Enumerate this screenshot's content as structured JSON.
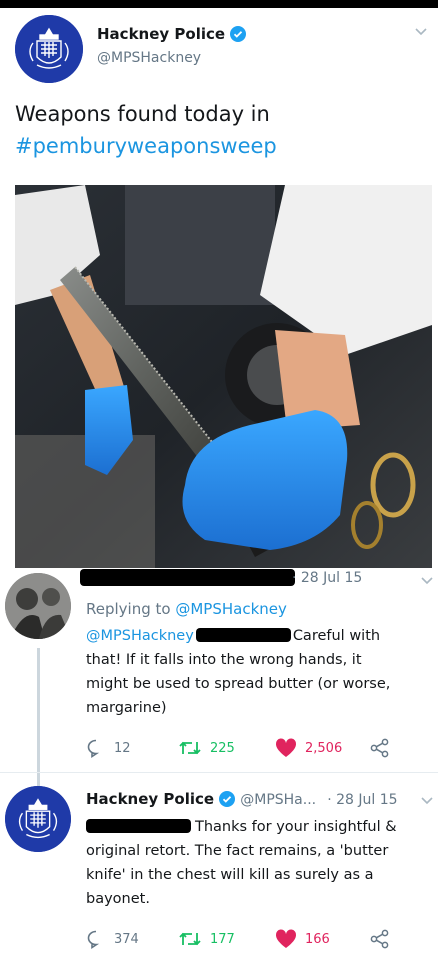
{
  "tweet": {
    "author_name": "Hackney Police",
    "author_handle": "@MPSHackney",
    "text_line1": "Weapons found today in",
    "hashtag": "#pemburyweaponsweep"
  },
  "reply1": {
    "date": "· 28 Jul 15",
    "replying_prefix": "Replying to ",
    "replying_handle": "@MPSHackney",
    "mention": "@MPSHackney",
    "text_after_mention": "Careful with",
    "text_line2": "that! If it falls into the wrong hands, it",
    "text_line3": "might be used to spread butter (or worse,",
    "text_line4": "margarine)",
    "replies": "12",
    "retweets": "225",
    "likes": "2,506"
  },
  "reply2": {
    "author_name": "Hackney Police",
    "author_handle": "@MPSHa...",
    "date": "· 28 Jul 15",
    "text_line1": "Thanks for your insightful &",
    "text_line2": "original retort. The fact remains, a 'butter",
    "text_line3": "knife' in the chest will kill as surely as a",
    "text_line4": "bayonet.",
    "replies": "374",
    "retweets": "177",
    "likes": "166"
  },
  "colors": {
    "link": "#1b95e0",
    "retweet": "#17bf63",
    "like": "#e0245e",
    "muted": "#657786",
    "police_blue": "#1f3aa8"
  },
  "icons": [
    "verified-icon",
    "chevron-down-icon",
    "reply-icon",
    "retweet-icon",
    "like-icon",
    "share-icon"
  ]
}
